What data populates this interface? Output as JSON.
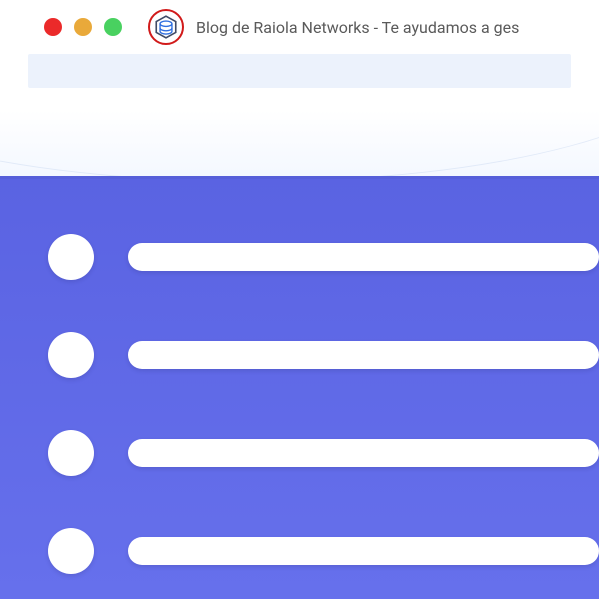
{
  "window": {
    "tab_title": "Blog de Raiola Networks - Te ayudamos a ges",
    "traffic_lights": {
      "close_color": "#eb2a2a",
      "minimize_color": "#e9a93a",
      "zoom_color": "#49d160"
    },
    "favicon": {
      "name": "raiola-hex-stack-icon",
      "highlight_circle_color": "#d11a1a"
    }
  },
  "url_bar": {
    "placeholder": ""
  },
  "content": {
    "list_items": [
      {
        "bullet": true,
        "bar": true
      },
      {
        "bullet": true,
        "bar": true
      },
      {
        "bullet": true,
        "bar": true
      },
      {
        "bullet": true,
        "bar": true
      }
    ]
  },
  "colors": {
    "panel": "#5c66e3",
    "paper": "#ffffff"
  }
}
